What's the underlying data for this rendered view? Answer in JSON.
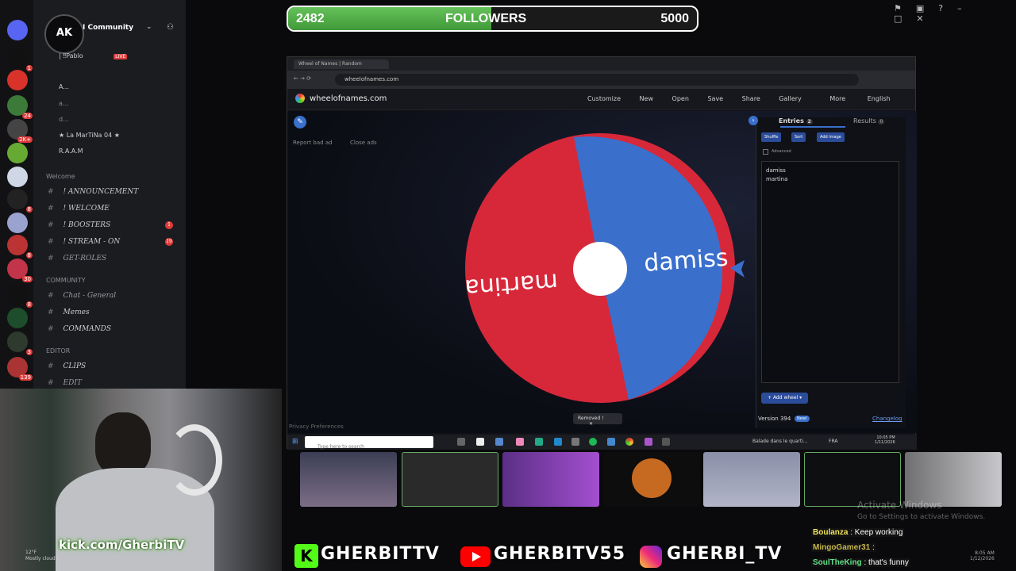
{
  "followers": {
    "current": "2482",
    "label": "FOLLOWERS",
    "goal": "5000",
    "progress": 0.4964
  },
  "discord": {
    "server_name": "I Community",
    "voice_users": [
      "| ‼Pablo",
      "A...",
      "a...",
      "d...",
      "★ La MarTiNa 04 ★",
      "R.A.A.M"
    ],
    "live_badge": "LIVE",
    "categories": {
      "welcome": "Welcome",
      "community": "COMMUNITY",
      "editor": "EDITOR"
    },
    "channels": [
      {
        "name": "! ANNOUNCEMENT"
      },
      {
        "name": "! WELCOME"
      },
      {
        "name": "! BOOSTERS",
        "badge": "1"
      },
      {
        "name": "! STREAM - ON",
        "badge": "19"
      },
      {
        "name": "GET-ROLES"
      },
      {
        "name": "Chat - General"
      },
      {
        "name": "Memes"
      },
      {
        "name": "COMMANDS"
      },
      {
        "name": "CLIPS"
      },
      {
        "name": "EDIT"
      }
    ],
    "server_badges": [
      "1",
      "24",
      "2K+",
      "8",
      "8",
      "30",
      "8",
      "1",
      "3",
      "139"
    ]
  },
  "browser": {
    "tab_title": "Wheel of Names | Random",
    "url": "wheelofnames.com",
    "site_name": "wheelofnames.com",
    "nav": [
      "Customize",
      "New",
      "Open",
      "Save",
      "Share",
      "Gallery",
      "More",
      "English"
    ],
    "report_ad": "Report bad ad",
    "close_ads": "Close ads",
    "wheel": {
      "segments": [
        {
          "name": "damiss",
          "color": "#3a6fcc"
        },
        {
          "name": "martina",
          "color": "#d7283a"
        }
      ]
    },
    "tabs": {
      "entries": "Entries",
      "entries_count": "2",
      "results": "Results",
      "results_count": "0"
    },
    "buttons": {
      "shuffle": "Shuffle",
      "sort": "Sort",
      "add_image": "Add image",
      "advanced": "Advanced",
      "add_wheel": "Add wheel"
    },
    "entries_text": "damiss\nmartina",
    "version": "Version 394",
    "new_badge": "New!",
    "changelog": "Changelog",
    "toast": "Removed !",
    "privacy": "Privacy Preferences",
    "search_placeholder": "Type here to search",
    "taskbar_news": "Balade dans le quarti...",
    "taskbar_lang": "FRA",
    "taskbar_time": "10:05 PM",
    "taskbar_date": "1/11/2026"
  },
  "overlay": {
    "kick": "kick.com/GherbiTV",
    "brand_text": "AK",
    "socials": [
      "GHERBITTV",
      "GHERBITV55",
      "GHERBI_TV"
    ],
    "watermark_title": "Activate Windows",
    "watermark_sub": "Go to Settings to activate Windows.",
    "weather_temp": "12°F",
    "weather_desc": "Mostly cloudy",
    "chat": [
      {
        "user": "Boulanza",
        "msg": ": Keep working"
      },
      {
        "user": "MingoGamer31",
        "msg": ":"
      },
      {
        "user": "SoulTheKing",
        "msg": ": that's funny"
      }
    ],
    "clock_time": "8:05 AM",
    "clock_date": "1/12/2026"
  }
}
